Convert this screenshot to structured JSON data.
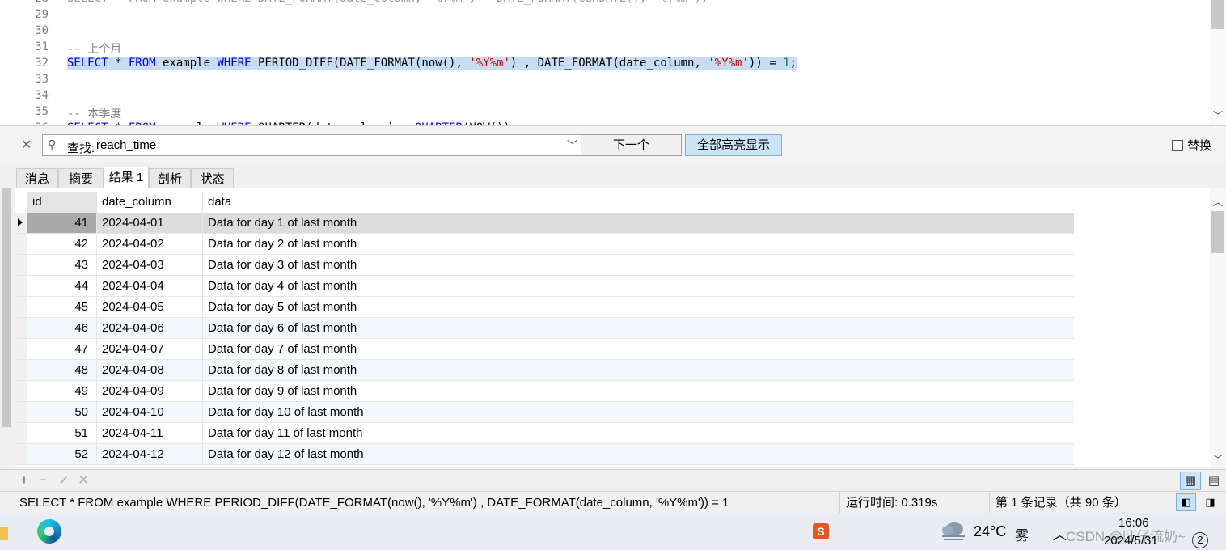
{
  "editor": {
    "lines": [
      {
        "num": "28",
        "cut_top": true,
        "tokens": [
          {
            "t": "SELECT * FROM example WHERE DATE_FORMAT(date_column, '%Y%m') = DATE_FORMAT(CURDATE(), '%Y%m');",
            "c": "cut"
          }
        ]
      },
      {
        "num": "29",
        "tokens": []
      },
      {
        "num": "30",
        "tokens": []
      },
      {
        "num": "31",
        "tokens": [
          {
            "t": "-- 上个月",
            "c": "com"
          }
        ]
      },
      {
        "num": "32",
        "highlight": true,
        "tokens": [
          {
            "t": "SELECT",
            "c": "kw"
          },
          {
            "t": " * ",
            "c": "plain"
          },
          {
            "t": "FROM",
            "c": "kw"
          },
          {
            "t": " example ",
            "c": "plain"
          },
          {
            "t": "WHERE",
            "c": "kw"
          },
          {
            "t": " PERIOD_DIFF(DATE_FORMAT(now(), ",
            "c": "plain"
          },
          {
            "t": "'%Y%m'",
            "c": "str"
          },
          {
            "t": ") , DATE_FORMAT(date_column, ",
            "c": "plain"
          },
          {
            "t": "'%Y%m'",
            "c": "str"
          },
          {
            "t": ")) = ",
            "c": "plain"
          },
          {
            "t": "1",
            "c": "num"
          },
          {
            "t": ";",
            "c": "plain"
          }
        ]
      },
      {
        "num": "33",
        "tokens": []
      },
      {
        "num": "34",
        "tokens": []
      },
      {
        "num": "35",
        "tokens": [
          {
            "t": "-- 本季度",
            "c": "com"
          }
        ]
      },
      {
        "num": "36",
        "cut_bottom": true,
        "tokens": [
          {
            "t": "SELECT",
            "c": "kw"
          },
          {
            "t": " * ",
            "c": "plain"
          },
          {
            "t": "FROM",
            "c": "kw"
          },
          {
            "t": " example ",
            "c": "plain"
          },
          {
            "t": "WHERE",
            "c": "kw"
          },
          {
            "t": " QUARTER(date_column) = ",
            "c": "plain"
          },
          {
            "t": "QUARTER",
            "c": "kw"
          },
          {
            "t": "(NOW());",
            "c": "plain"
          }
        ]
      }
    ]
  },
  "find": {
    "prefix": "查找:",
    "value": "reach_time",
    "next_label": "下一个",
    "highlight_all_label": "全部高亮显示",
    "replace_label": "替换"
  },
  "tabs": [
    {
      "label": "消息",
      "active": false
    },
    {
      "label": "摘要",
      "active": false
    },
    {
      "label": "结果 1",
      "active": true
    },
    {
      "label": "剖析",
      "active": false
    },
    {
      "label": "状态",
      "active": false
    }
  ],
  "grid": {
    "columns": [
      "id",
      "date_column",
      "data"
    ],
    "rows": [
      {
        "id": "41",
        "date": "2024-04-01",
        "data": "Data for day 1 of last month"
      },
      {
        "id": "42",
        "date": "2024-04-02",
        "data": "Data for day 2 of last month"
      },
      {
        "id": "43",
        "date": "2024-04-03",
        "data": "Data for day 3 of last month"
      },
      {
        "id": "44",
        "date": "2024-04-04",
        "data": "Data for day 4 of last month"
      },
      {
        "id": "45",
        "date": "2024-04-05",
        "data": "Data for day 5 of last month"
      },
      {
        "id": "46",
        "date": "2024-04-06",
        "data": "Data for day 6 of last month"
      },
      {
        "id": "47",
        "date": "2024-04-07",
        "data": "Data for day 7 of last month"
      },
      {
        "id": "48",
        "date": "2024-04-08",
        "data": "Data for day 8 of last month"
      },
      {
        "id": "49",
        "date": "2024-04-09",
        "data": "Data for day 9 of last month"
      },
      {
        "id": "50",
        "date": "2024-04-10",
        "data": "Data for day 10 of last month"
      },
      {
        "id": "51",
        "date": "2024-04-11",
        "data": "Data for day 11 of last month"
      },
      {
        "id": "52",
        "date": "2024-04-12",
        "data": "Data for day 12 of last month"
      }
    ],
    "selected_index": 0
  },
  "toolbar": {
    "add": "+",
    "remove": "−",
    "apply": "✓",
    "discard": "✕"
  },
  "status": {
    "query": "SELECT * FROM example WHERE PERIOD_DIFF(DATE_FORMAT(now(), '%Y%m') , DATE_FORMAT(date_column, '%Y%m')) = 1",
    "runtime": "运行时间: 0.319s",
    "record": "第 1 条记录（共 90 条）"
  },
  "taskbar": {
    "sogou_label": "S",
    "temperature": "24°C",
    "weather": "雾",
    "tray_chevron": "︿",
    "watermark": "CSDN @旺仔流奶~",
    "time": "16:06",
    "date": "2024/5/31",
    "notification_count": "2"
  },
  "colors": {
    "accent": "#cce4f7",
    "keyword": "#0000ff",
    "string": "#d00000",
    "number": "#098658",
    "comment": "#808080",
    "line_highlight": "#c8dcf2"
  }
}
